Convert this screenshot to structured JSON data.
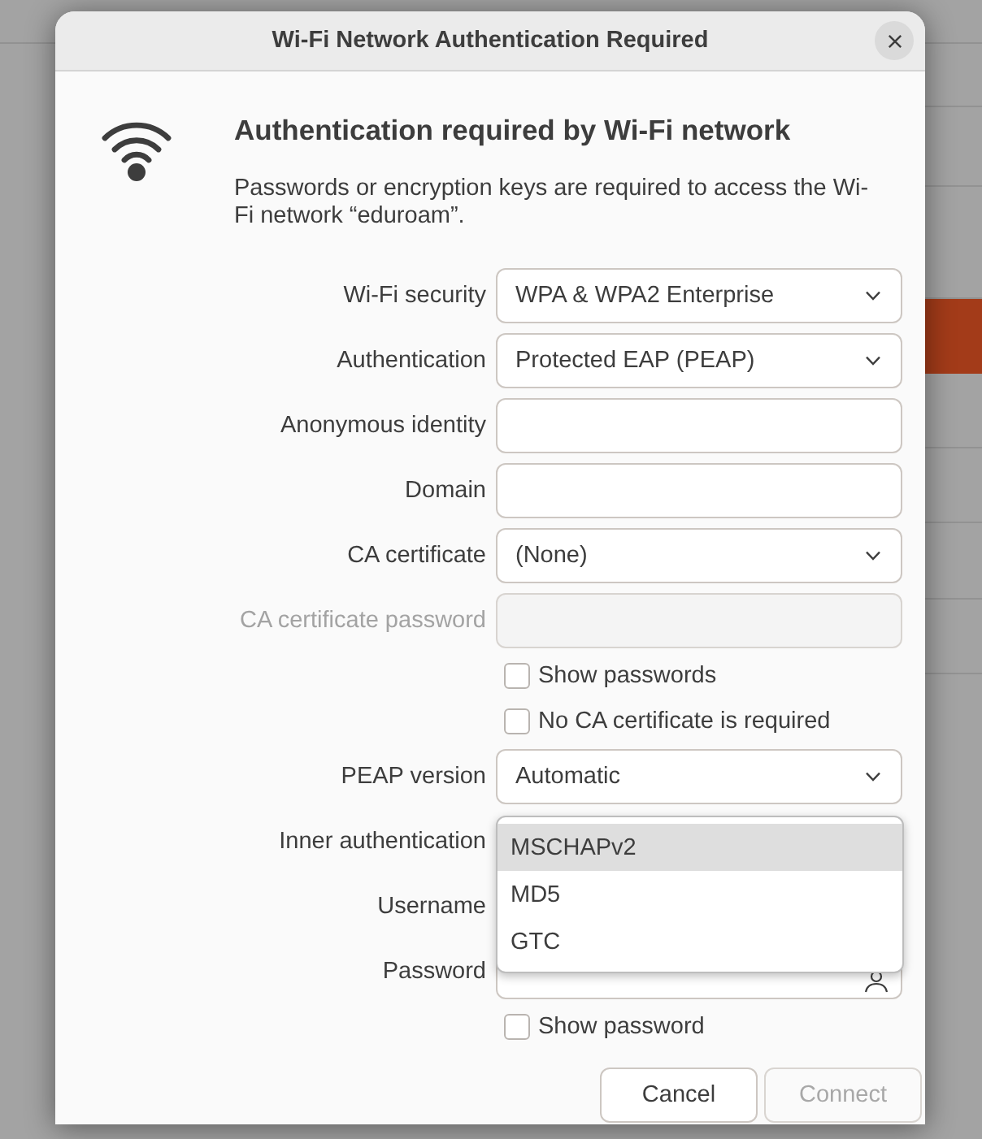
{
  "window": {
    "title": "Wi-Fi Network Authentication Required"
  },
  "heading": "Authentication required by Wi-Fi network",
  "message": "Passwords or encryption keys are required to access the Wi-Fi network “eduroam”.",
  "fields": [
    {
      "kind": "dropdown",
      "label": "Wi-Fi security",
      "value": "WPA & WPA2 Enterprise",
      "disabled": false,
      "expanded": false
    },
    {
      "kind": "dropdown",
      "label": "Authentication",
      "value": "Protected EAP (PEAP)",
      "disabled": false,
      "expanded": false
    },
    {
      "kind": "text",
      "label": "Anonymous identity",
      "disabled": false
    },
    {
      "kind": "text",
      "label": "Domain",
      "disabled": false
    },
    {
      "kind": "dropdown",
      "label": "CA certificate",
      "value": "(None)",
      "disabled": false,
      "expanded": false
    },
    {
      "kind": "text",
      "label": "CA certificate password",
      "disabled": true
    },
    {
      "kind": "checkbox",
      "label": "Show passwords",
      "checked": false,
      "disabled": false
    },
    {
      "kind": "checkbox",
      "label": "No CA certificate is required",
      "checked": false,
      "disabled": false
    },
    {
      "kind": "dropdown",
      "label": "PEAP version",
      "value": "Automatic",
      "disabled": false,
      "expanded": false
    },
    {
      "kind": "dropdown",
      "label": "Inner authentication",
      "disabled": false,
      "expanded": true,
      "options": [
        {
          "label": "MSCHAPv2",
          "selected": true
        },
        {
          "label": "MD5",
          "selected": false
        },
        {
          "label": "GTC",
          "selected": false
        }
      ]
    },
    {
      "kind": "text",
      "label": "Username",
      "disabled": false
    },
    {
      "kind": "password",
      "label": "Password",
      "disabled": false
    },
    {
      "kind": "checkbox",
      "label": "Show password",
      "checked": false,
      "disabled": false
    }
  ],
  "buttons": [
    {
      "label": "Cancel",
      "disabled": false
    },
    {
      "label": "Connect",
      "disabled": true
    }
  ]
}
